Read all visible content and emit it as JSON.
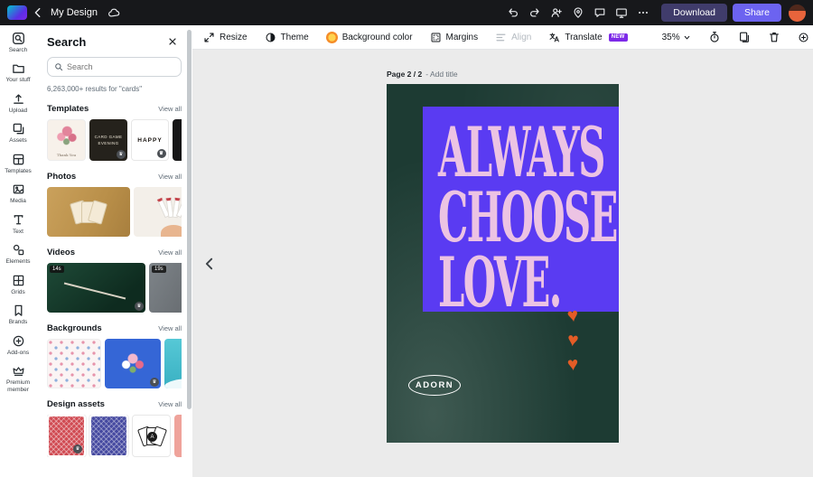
{
  "colors": {
    "topbar_bg": "#17181b",
    "download_bg": "#403c6b",
    "share_bg": "#6c63f0",
    "new_badge": "#7d2ae8",
    "poster_bg": "#1d3b33",
    "poster_panel": "#5a3bf2",
    "poster_text": "#ecc3e3",
    "heart": "#e35c26"
  },
  "topbar": {
    "title": "My Design",
    "download": "Download",
    "share": "Share"
  },
  "rail": {
    "items": [
      {
        "label": "Search"
      },
      {
        "label": "Your stuff"
      },
      {
        "label": "Upload"
      },
      {
        "label": "Assets"
      },
      {
        "label": "Templates"
      },
      {
        "label": "Media"
      },
      {
        "label": "Text"
      },
      {
        "label": "Elements"
      },
      {
        "label": "Grids"
      },
      {
        "label": "Brands"
      },
      {
        "label": "Add-ons"
      },
      {
        "label": "Premium member"
      }
    ]
  },
  "panel": {
    "title": "Search",
    "search_placeholder": "Search",
    "results": "6,263,000+ results for \"cards\"",
    "sections": [
      {
        "title": "Templates",
        "view_all": "View all",
        "thumbs": [
          {
            "name": "floral-thank-you-card",
            "label": "Thank You"
          },
          {
            "name": "card-game-evening-card",
            "label": "Card Game Evening"
          },
          {
            "name": "happy-card",
            "label": "HAPPY"
          },
          {
            "name": "dark-card"
          }
        ]
      },
      {
        "title": "Photos",
        "view_all": "View all",
        "thumbs": [
          {
            "name": "golden-playing-cards-photo"
          },
          {
            "name": "hand-holding-cards-photo"
          }
        ]
      },
      {
        "title": "Videos",
        "view_all": "View all",
        "thumbs": [
          {
            "name": "pool-table-video",
            "duration": "14s"
          },
          {
            "name": "cards-video",
            "duration": "19s"
          }
        ]
      },
      {
        "title": "Backgrounds",
        "view_all": "View all",
        "thumbs": [
          {
            "name": "umbrella-pattern-background"
          },
          {
            "name": "flower-bouquet-background"
          },
          {
            "name": "teal-background"
          }
        ]
      },
      {
        "title": "Design assets",
        "view_all": "View all",
        "thumbs": [
          {
            "name": "red-card-back"
          },
          {
            "name": "purple-card-back"
          },
          {
            "name": "fanned-cards",
            "label": "A"
          },
          {
            "name": "hand-with-card"
          }
        ]
      }
    ]
  },
  "toolbar": {
    "resize": "Resize",
    "theme": "Theme",
    "background_color": "Background color",
    "margins": "Margins",
    "align": "Align",
    "translate": "Translate",
    "new_badge": "NEW",
    "zoom": "35%",
    "add": "Add"
  },
  "canvas": {
    "page_label": "Page 2 / 2",
    "add_title": "- Add title",
    "poster": {
      "line1": "ALWAYS",
      "line2": "CHOOSE",
      "line3": "LOVE.",
      "brand": "ADORN",
      "heart_glyph": "♥"
    }
  }
}
